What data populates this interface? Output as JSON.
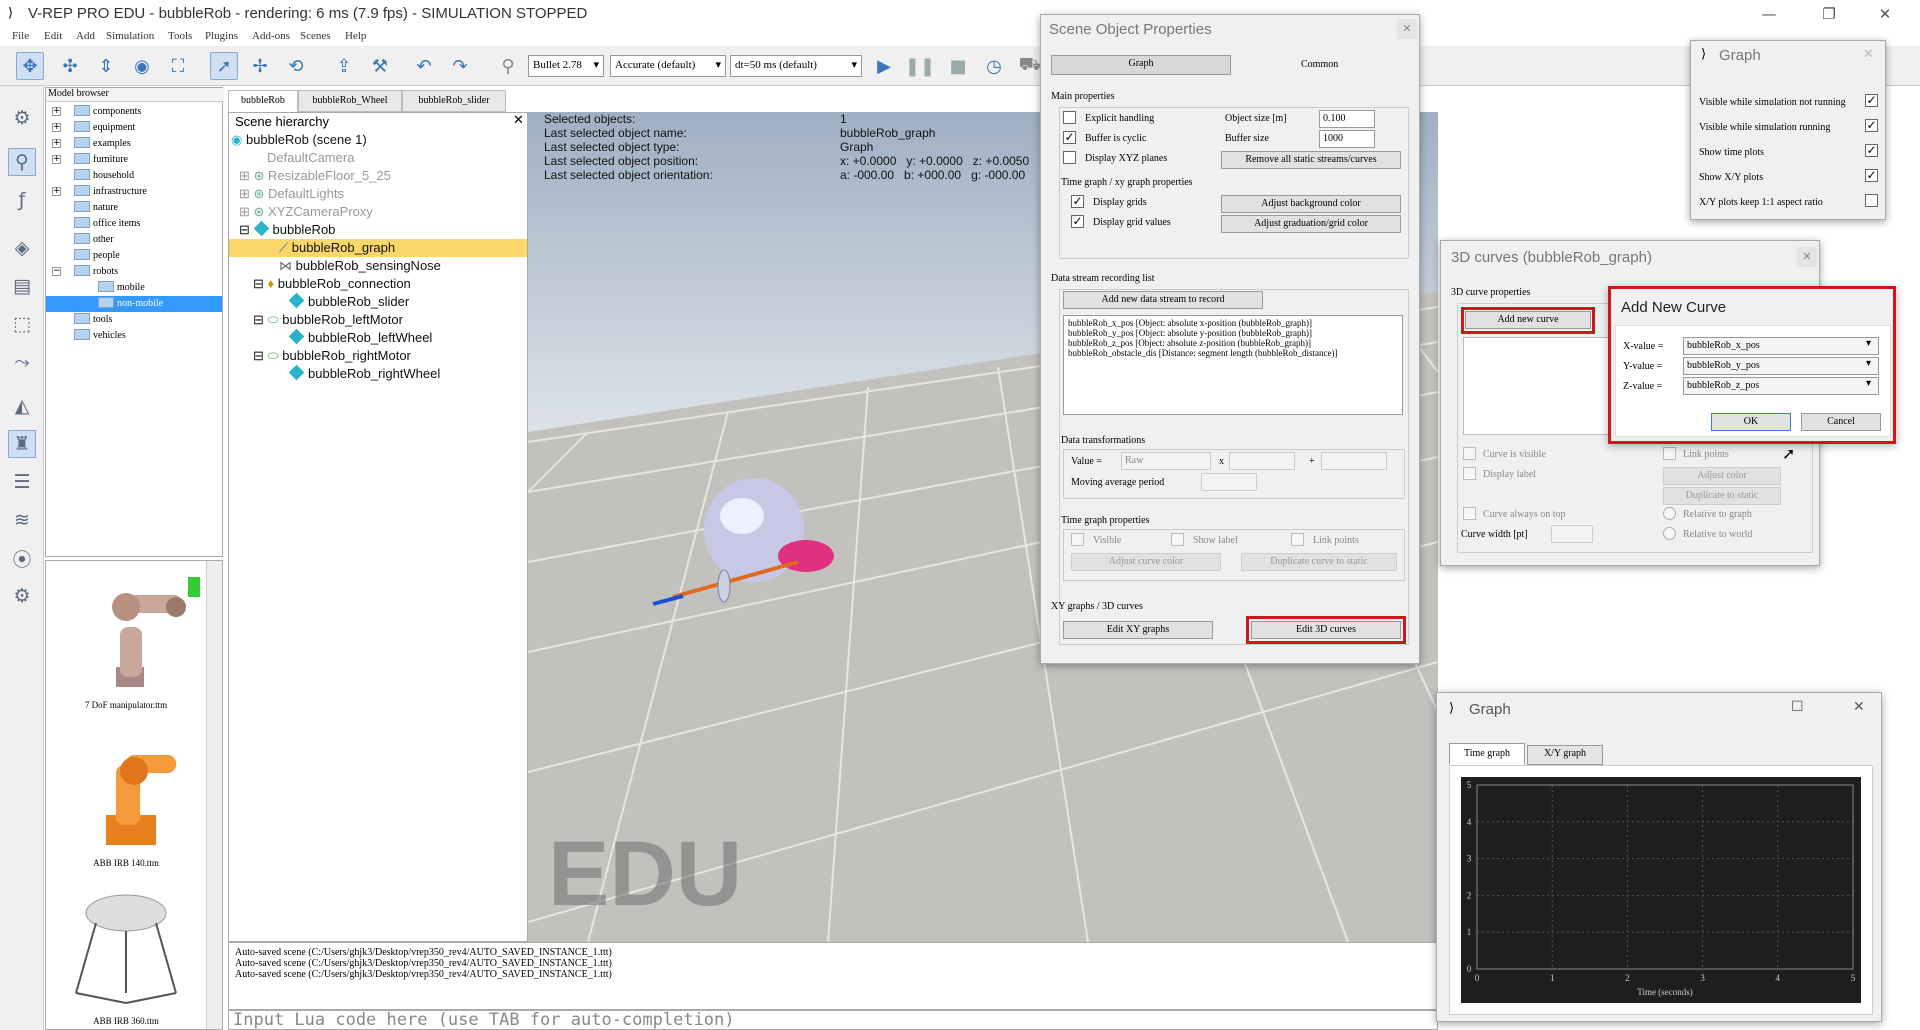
{
  "window": {
    "title": "V-REP PRO EDU - bubbleRob - rendering: 6 ms (7.9 fps) - SIMULATION STOPPED"
  },
  "menu": [
    "File",
    "Edit",
    "Add",
    "Simulation",
    "Tools",
    "Plugins",
    "Add-ons",
    "Scenes",
    "Help"
  ],
  "toolbar": {
    "engine": "Bullet 2.78",
    "accuracy": "Accurate (default)",
    "dt": "dt=50 ms (default)"
  },
  "model_browser": {
    "header": "Model browser",
    "items": [
      "components",
      "equipment",
      "examples",
      "furniture",
      "household",
      "infrastructure",
      "nature",
      "office items",
      "other",
      "people",
      "robots",
      "mobile",
      "non-mobile",
      "tools",
      "vehicles"
    ]
  },
  "thumbnails": [
    "7 DoF manipulator.ttm",
    "ABB IRB 140.ttm",
    "ABB IRB 360.ttm"
  ],
  "tabs": [
    "bubbleRob",
    "bubbleRob_Wheel",
    "bubbleRob_slider"
  ],
  "hierarchy": {
    "header": "Scene hierarchy",
    "nodes": [
      "bubbleRob (scene 1)",
      "DefaultCamera",
      "ResizableFloor_5_25",
      "DefaultLights",
      "XYZCameraProxy",
      "bubbleRob",
      "bubbleRob_graph",
      "bubbleRob_sensingNose",
      "bubbleRob_connection",
      "bubbleRob_slider",
      "bubbleRob_leftMotor",
      "bubbleRob_leftWheel",
      "bubbleRob_rightMotor",
      "bubbleRob_rightWheel"
    ]
  },
  "info": {
    "l1": "Selected objects:",
    "v1": "1",
    "l2": "Last selected object name:",
    "v2": "bubbleRob_graph",
    "l3": "Last selected object type:",
    "v3": "Graph",
    "l4": "Last selected object position:",
    "v4": "x: +0.0000   y: +0.0000   z: +0.0050",
    "l5": "Last selected object orientation:",
    "v5": "a: -000.00   b: +000.00   g: -000.00"
  },
  "viewport": {
    "watermark": "EDU"
  },
  "console": [
    "Auto-saved scene (C:/Users/ghjk3/Desktop/vrep350_rev4/AUTO_SAVED_INSTANCE_1.ttt)",
    "Auto-saved scene (C:/Users/ghjk3/Desktop/vrep350_rev4/AUTO_SAVED_INSTANCE_1.ttt)",
    "Auto-saved scene (C:/Users/ghjk3/Desktop/vrep350_rev4/AUTO_SAVED_INSTANCE_1.ttt)"
  ],
  "lua": {
    "placeholder": "Input Lua code here (use TAB for auto-completion)"
  },
  "sop": {
    "title": "Scene Object Properties",
    "tab_graph": "Graph",
    "tab_common": "Common",
    "main_props": "Main properties",
    "explicit": "Explicit handling",
    "cyclic": "Buffer is cyclic",
    "xyz": "Display XYZ planes",
    "objsize_l": "Object size [m]",
    "objsize_v": "0.100",
    "bufsize_l": "Buffer size",
    "bufsize_v": "1000",
    "remove_btn": "Remove all static streams/curves",
    "timegraph_props": "Time graph / xy graph properties",
    "disp_grids": "Display grids",
    "disp_vals": "Display grid values",
    "adj_bg": "Adjust background color",
    "adj_grad": "Adjust graduation/grid color",
    "ds_list": "Data stream recording list",
    "add_ds": "Add new data stream to record",
    "streams": [
      "bubbleRob_x_pos [Object: absolute x-position (bubbleRob_graph)]",
      "bubbleRob_y_pos [Object: absolute y-position (bubbleRob_graph)]",
      "bubbleRob_z_pos [Object: absolute z-position (bubbleRob_graph)]",
      "bubbleRob_obstacle_dis [Distance: segment length (bubbleRob_distance)]"
    ],
    "data_tr": "Data transformations",
    "value_l": "Value =",
    "value_v": "Raw",
    "x_l": "x",
    "plus_l": "+",
    "mov_avg": "Moving average period",
    "tg_props": "Time graph properties",
    "visible": "Visible",
    "show_label": "Show label",
    "link_pts": "Link points",
    "adj_curve": "Adjust curve color",
    "dup_curve": "Duplicate curve to static",
    "xy_3d": "XY graphs / 3D curves",
    "edit_xy": "Edit XY graphs",
    "edit_3d": "Edit 3D curves"
  },
  "graph_opts": {
    "title": "Graph",
    "items": [
      "Visible while simulation not running",
      "Visible while simulation running",
      "Show time plots",
      "Show X/Y plots",
      "X/Y plots keep 1:1 aspect ratio"
    ],
    "checked": [
      true,
      true,
      true,
      true,
      false
    ]
  },
  "curves3d": {
    "title": "3D curves (bubbleRob_graph)",
    "props": "3D curve properties",
    "add": "Add new curve",
    "visible": "Curve is visible",
    "disp_label": "Display label",
    "on_top": "Curve always on top",
    "width": "Curve width [pt]",
    "link": "Link points",
    "adj_color": "Adjust color",
    "dup": "Duplicate to static",
    "rel_graph": "Relative to graph",
    "rel_world": "Relative to world"
  },
  "add_curve": {
    "title": "Add New Curve",
    "x_l": "X-value =",
    "x_v": "bubbleRob_x_pos",
    "y_l": "Y-value =",
    "y_v": "bubbleRob_y_pos",
    "z_l": "Z-value =",
    "z_v": "bubbleRob_z_pos",
    "ok": "OK",
    "cancel": "Cancel"
  },
  "graph_win": {
    "title": "Graph",
    "tab_time": "Time graph",
    "tab_xy": "X/Y graph",
    "xlabel": "Time (seconds)"
  },
  "chart_data": {
    "type": "line",
    "title": "",
    "xlabel": "Time (seconds)",
    "ylabel": "",
    "xlim": [
      0,
      5
    ],
    "ylim": [
      0,
      5
    ],
    "x_ticks": [
      "0",
      "1",
      "2",
      "3",
      "4",
      "5"
    ],
    "y_ticks": [
      "0",
      "1",
      "2",
      "3",
      "4",
      "5"
    ],
    "grid": true,
    "series": []
  },
  "colors": {
    "accent": "#3a76b8",
    "selection": "#fbd76a",
    "highlight": "#d0151c",
    "plot_bg": "#1e1e1e"
  }
}
